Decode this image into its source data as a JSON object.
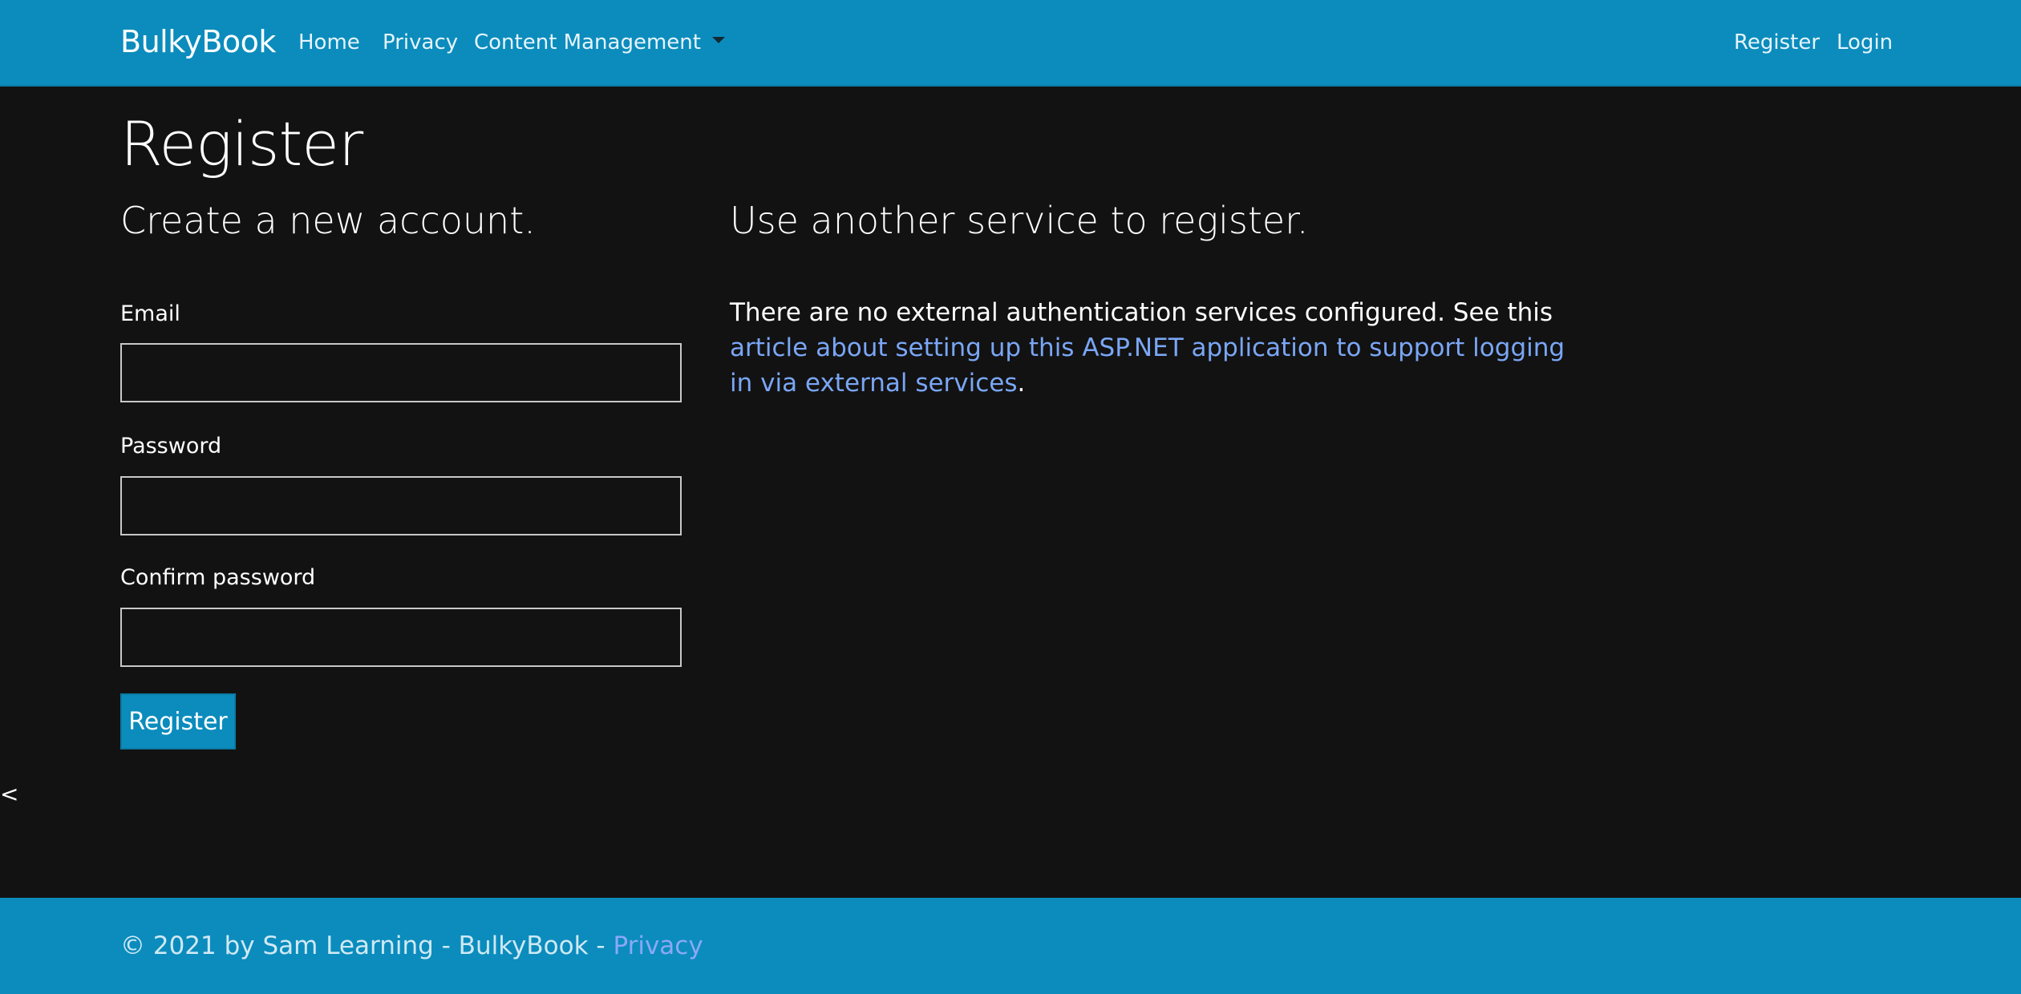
{
  "navbar": {
    "brand": "BulkyBook",
    "links": [
      {
        "label": "Home"
      },
      {
        "label": "Privacy"
      },
      {
        "label": "Content Management"
      }
    ],
    "right_links": [
      {
        "label": "Register"
      },
      {
        "label": "Login"
      }
    ]
  },
  "main": {
    "title": "Register",
    "left": {
      "heading": "Create a new account.",
      "email_label": "Email",
      "email_value": "",
      "password_label": "Password",
      "password_value": "",
      "confirm_label": "Confirm password",
      "confirm_value": "",
      "submit_label": "Register"
    },
    "right": {
      "heading": "Use another service to register.",
      "text_before": "There are no external authentication services configured. See this ",
      "link_text": "article about setting up this ASP.NET application to support logging in via external services",
      "text_after": "."
    },
    "stray_glyph": "<"
  },
  "footer": {
    "text": "© 2021 by Sam Learning - BulkyBook - ",
    "link": "Privacy"
  },
  "colors": {
    "brand": "#0b8cbd",
    "background": "#121212",
    "link": "#7aa6f5"
  }
}
